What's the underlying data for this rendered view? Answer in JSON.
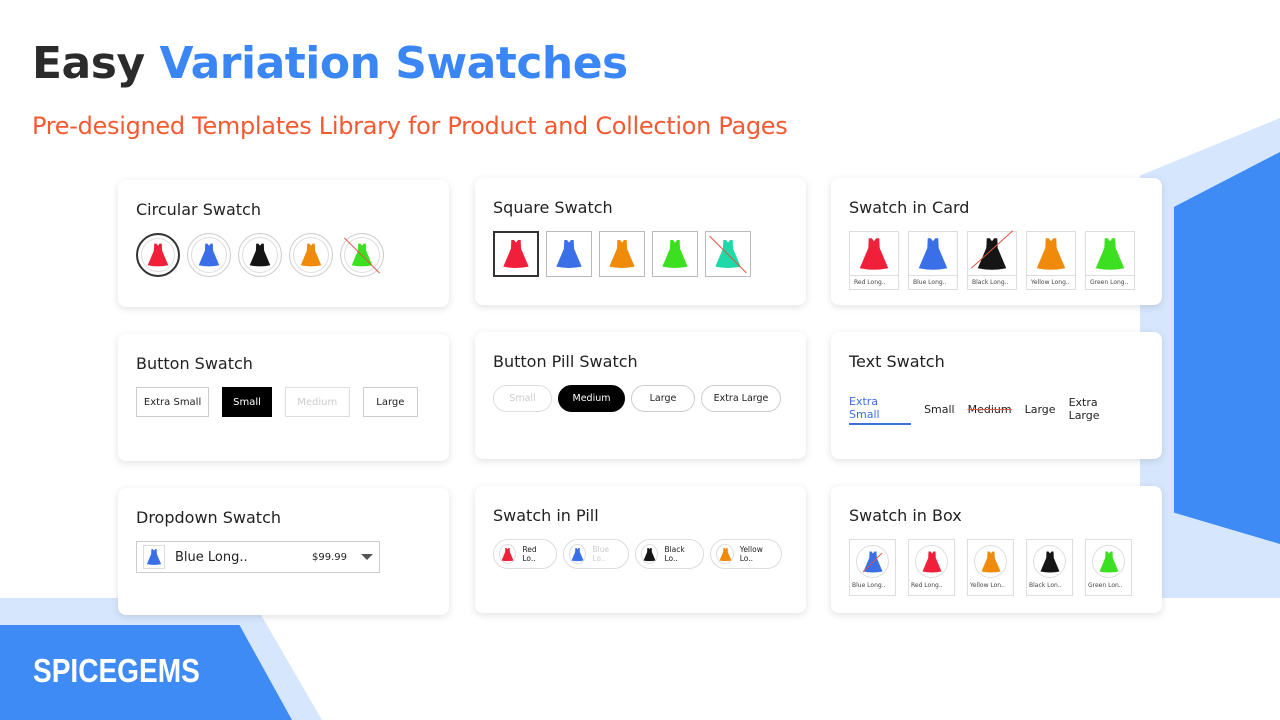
{
  "title": {
    "part1": "Easy",
    "part2": "Variation Swatches"
  },
  "subtitle": "Pre-designed Templates Library for Product and Collection Pages",
  "brand": "SPICEGEMS",
  "colors": {
    "red": "#f0203a",
    "blue": "#3a6fe8",
    "black": "#151515",
    "yellow": "#f08a0a",
    "green": "#3de020",
    "teal": "#1fd9a8",
    "accent": "#3a86f5",
    "subtitle": "#f45a32"
  },
  "cards": {
    "circular": {
      "title": "Circular Swatch",
      "items": [
        {
          "color": "red",
          "state": "selected"
        },
        {
          "color": "blue"
        },
        {
          "color": "black"
        },
        {
          "color": "yellow"
        },
        {
          "color": "green",
          "state": "unavailable"
        }
      ]
    },
    "square": {
      "title": "Square Swatch",
      "items": [
        {
          "color": "red",
          "state": "selected"
        },
        {
          "color": "blue"
        },
        {
          "color": "yellow"
        },
        {
          "color": "green"
        },
        {
          "color": "teal",
          "state": "unavailable"
        }
      ]
    },
    "card": {
      "title": "Swatch in Card",
      "items": [
        {
          "color": "red",
          "label": "Red Long.."
        },
        {
          "color": "blue",
          "label": "Blue Long.."
        },
        {
          "color": "black",
          "label": "Black Long..",
          "state": "unavailable"
        },
        {
          "color": "yellow",
          "label": "Yellow Long.."
        },
        {
          "color": "green",
          "label": "Green Long.."
        }
      ]
    },
    "button": {
      "title": "Button Swatch",
      "items": [
        {
          "label": "Extra Small"
        },
        {
          "label": "Small",
          "state": "selected"
        },
        {
          "label": "Medium",
          "state": "disabled"
        },
        {
          "label": "Large"
        }
      ]
    },
    "pill": {
      "title": "Button Pill Swatch",
      "items": [
        {
          "label": "Small",
          "state": "disabled"
        },
        {
          "label": "Medium",
          "state": "selected"
        },
        {
          "label": "Large"
        },
        {
          "label": "Extra Large"
        }
      ]
    },
    "text": {
      "title": "Text Swatch",
      "items": [
        {
          "label": "Extra Small",
          "state": "selected"
        },
        {
          "label": "Small"
        },
        {
          "label": "Medium",
          "state": "disabled"
        },
        {
          "label": "Large"
        },
        {
          "label": "Extra Large"
        }
      ]
    },
    "dropdown": {
      "title": "Dropdown Swatch",
      "selected": {
        "color": "blue",
        "label": "Blue Long..",
        "price": "$99.99"
      }
    },
    "swatchpill": {
      "title": "Swatch in Pill",
      "items": [
        {
          "color": "red",
          "label": "Red Lo.."
        },
        {
          "color": "blue",
          "label": "Blue Lo..",
          "state": "disabled"
        },
        {
          "color": "black",
          "label": "Black Lo.."
        },
        {
          "color": "yellow",
          "label": "Yellow Lo.."
        }
      ]
    },
    "box": {
      "title": "Swatch in Box",
      "items": [
        {
          "color": "blue",
          "label": "Blue Long..",
          "state": "unavailable"
        },
        {
          "color": "red",
          "label": "Red Long.."
        },
        {
          "color": "yellow",
          "label": "Yellow Lon.."
        },
        {
          "color": "black",
          "label": "Black Lon.."
        },
        {
          "color": "green",
          "label": "Green Lon.."
        }
      ]
    }
  }
}
